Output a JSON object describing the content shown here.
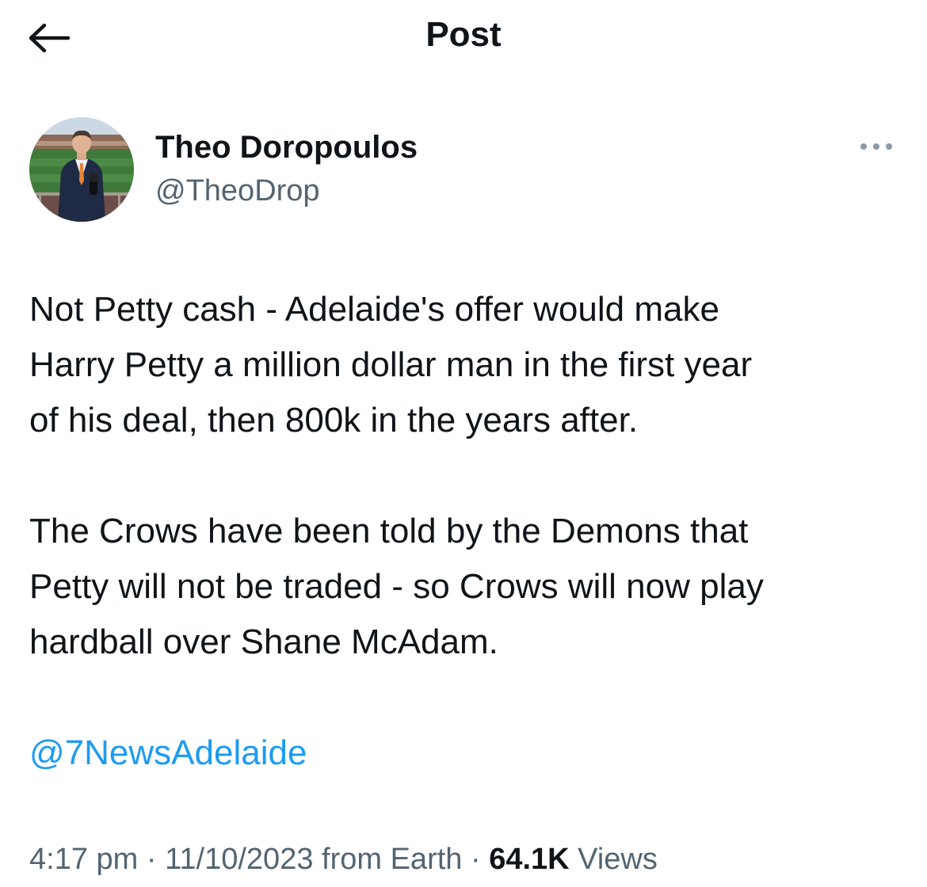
{
  "header": {
    "title": "Post",
    "back_icon": "back-arrow-icon"
  },
  "author": {
    "display_name": "Theo Doropoulos",
    "handle": "@TheoDrop",
    "avatar_icon": "avatar"
  },
  "more_icon": "more-horizontal-icon",
  "tweet": {
    "paragraph_1": "Not Petty cash - Adelaide's offer would make\nHarry Petty a million dollar man in the first year\nof his deal, then 800k in the years after.",
    "paragraph_2": "The Crows have been told by the Demons that\nPetty will not be traded - so Crows will now play\nhardball over Shane McAdam.",
    "mention": "@7NewsAdelaide"
  },
  "meta": {
    "time": "4:17 pm",
    "separator": "·",
    "date": "11/10/2023",
    "source": "from Earth",
    "views_count": "64.1K",
    "views_label": "Views"
  },
  "colors": {
    "text": "#0f1419",
    "secondary": "#536471",
    "link": "#1d9bf0"
  }
}
